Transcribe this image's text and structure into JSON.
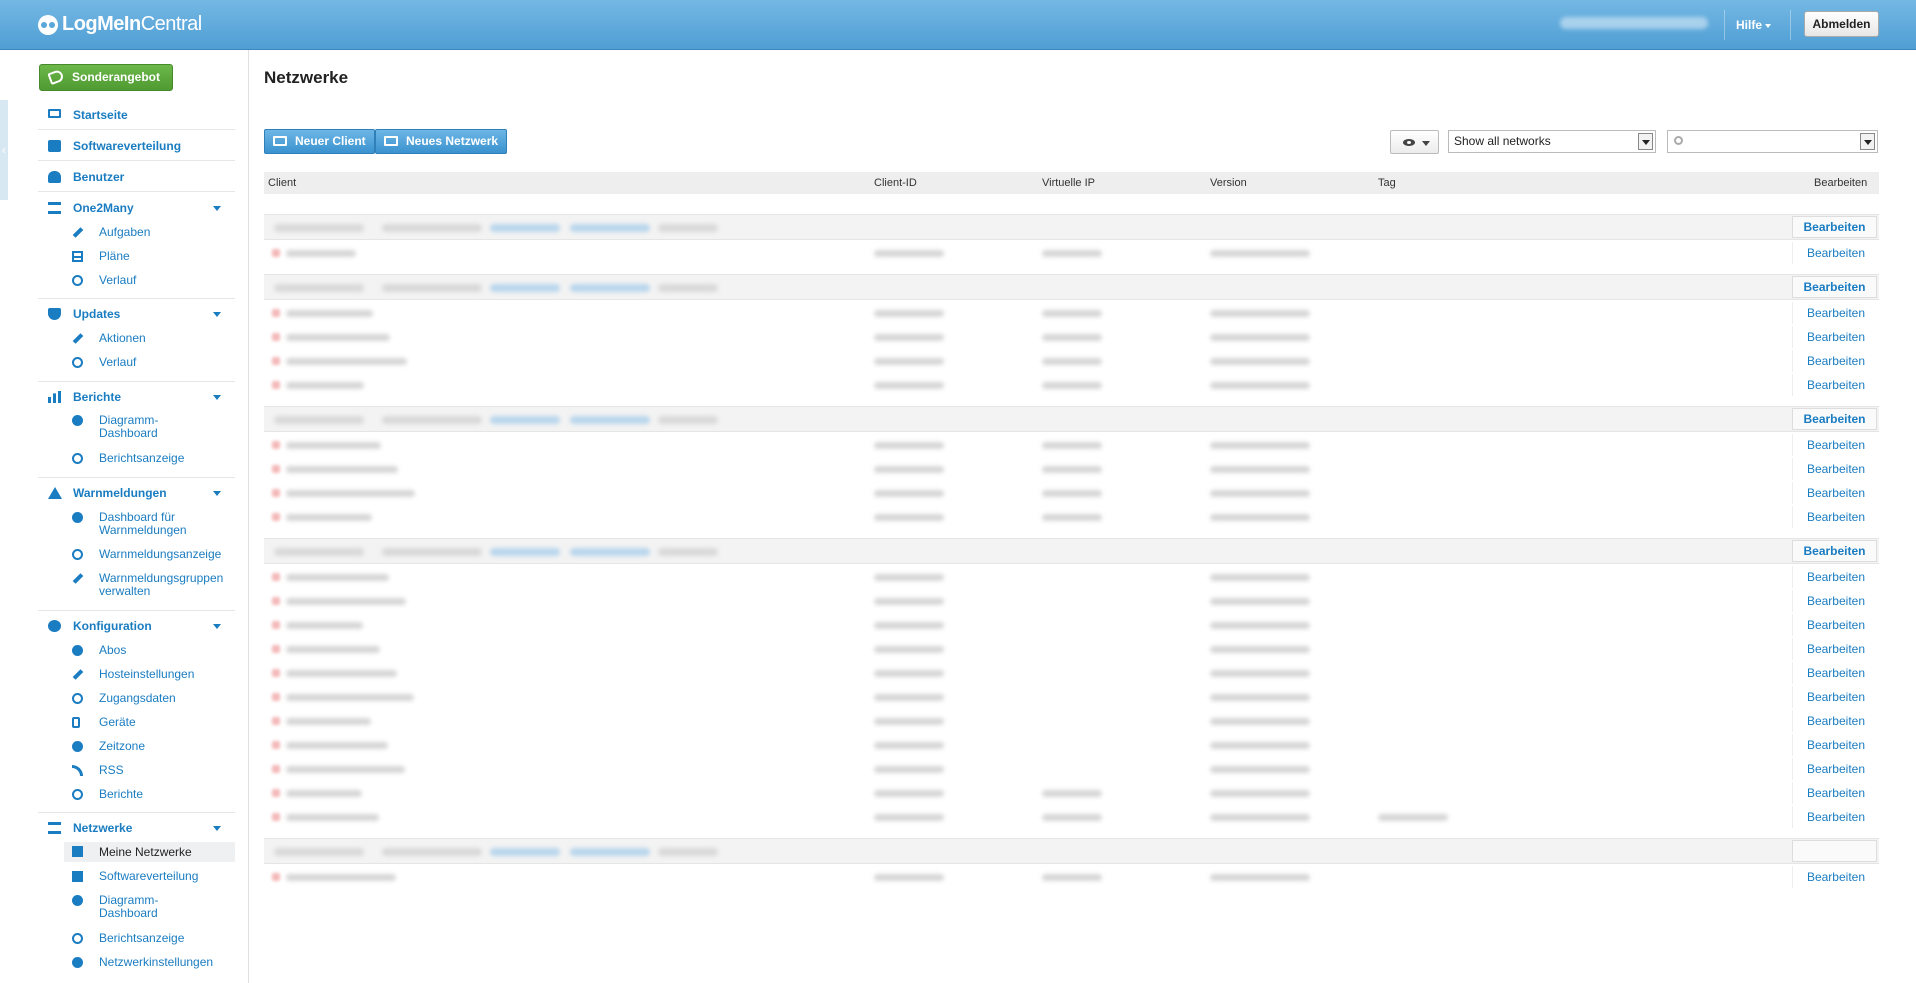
{
  "header": {
    "logo_bold": "LogMeIn",
    "logo_light": "Central",
    "help_label": "Hilfe",
    "logout_label": "Abmelden"
  },
  "sidebar": {
    "offer_label": "Sonderangebot",
    "items": [
      {
        "label": "Startseite",
        "icon": "monitor-icon"
      },
      {
        "label": "Softwareverteilung",
        "icon": "package-icon"
      },
      {
        "label": "Benutzer",
        "icon": "user-icon"
      },
      {
        "label": "One2Many",
        "icon": "hierarchy-icon",
        "subs": [
          "Aufgaben",
          "Pläne",
          "Verlauf"
        ]
      },
      {
        "label": "Updates",
        "icon": "shield-icon",
        "subs": [
          "Aktionen",
          "Verlauf"
        ]
      },
      {
        "label": "Berichte",
        "icon": "bar-chart-icon",
        "subs": [
          "Diagramm-Dashboard",
          "Berichtsanzeige"
        ]
      },
      {
        "label": "Warnmeldungen",
        "icon": "warning-icon",
        "subs": [
          "Dashboard für Warnmeldungen",
          "Warnmeldungsanzeige",
          "Warnmeldungsgruppen verwalten"
        ]
      },
      {
        "label": "Konfiguration",
        "icon": "gear-icon",
        "subs": [
          "Abos",
          "Hosteinstellungen",
          "Zugangsdaten",
          "Geräte",
          "Zeitzone",
          "RSS",
          "Berichte"
        ]
      },
      {
        "label": "Netzwerke",
        "icon": "network-icon",
        "subs": [
          "Meine Netzwerke",
          "Softwareverteilung",
          "Diagramm-Dashboard",
          "Berichtsanzeige",
          "Netzwerkinstellungen"
        ]
      }
    ],
    "sub_lines": {
      "diagramm_1": [
        "Diagramm-",
        "Dashboard"
      ],
      "warn_dash": [
        "Dashboard für",
        "Warnmeldungen"
      ],
      "warn_groups": [
        "Warnmeldungsgruppen",
        "verwalten"
      ],
      "diagramm_2": [
        "Diagramm-",
        "Dashboard"
      ]
    }
  },
  "main": {
    "title": "Netzwerke",
    "new_client_label": "Neuer Client",
    "new_network_label": "Neues Netzwerk",
    "network_filter_value": "Show all networks",
    "columns": [
      "Client",
      "Client-ID",
      "Virtuelle IP",
      "Version",
      "Tag",
      "Bearbeiten"
    ],
    "edit_label": "Bearbeiten"
  },
  "colors": {
    "header": "#5aa7da",
    "accent": "#1a7cc1",
    "offer": "#5aa53b"
  }
}
